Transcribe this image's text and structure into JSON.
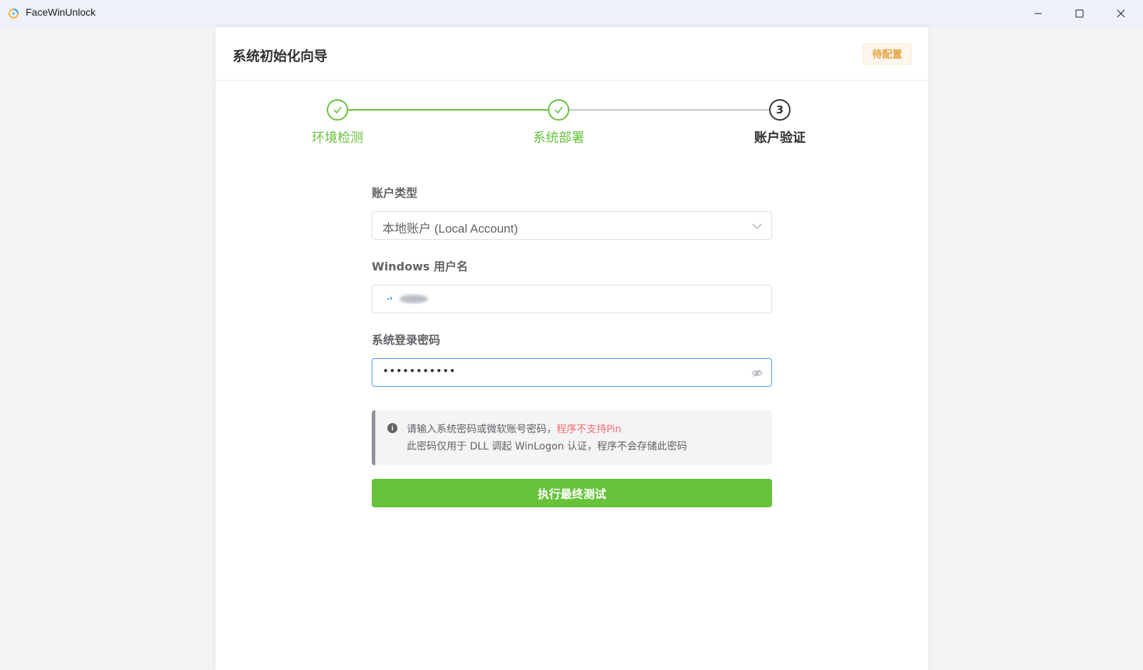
{
  "window": {
    "title": "FaceWinUnlock",
    "icon": "app-logo-icon"
  },
  "card": {
    "title": "系统初始化向导",
    "status_tag": "待配置"
  },
  "steps": [
    {
      "label": "环境检测",
      "state": "done"
    },
    {
      "label": "系统部署",
      "state": "done"
    },
    {
      "number": "3",
      "label": "账户验证",
      "state": "active"
    }
  ],
  "form": {
    "account_type_label": "账户类型",
    "account_type_value": "本地账户 (Local Account)",
    "username_label": "Windows 用户名",
    "password_label": "系统登录密码",
    "password_value": "•••••••••••"
  },
  "notice": {
    "line1_prefix": "请输入系统密码或微软账号密码，",
    "line1_warning": "程序不支持Pin",
    "line2": "此密码仅用于 DLL 调起 WinLogon 认证，程序不会存储此密码"
  },
  "submit_label": "执行最终测试",
  "colors": {
    "success": "#67c23a",
    "warning": "#e6a23c",
    "danger": "#f56c6c",
    "focus": "#409eff"
  }
}
